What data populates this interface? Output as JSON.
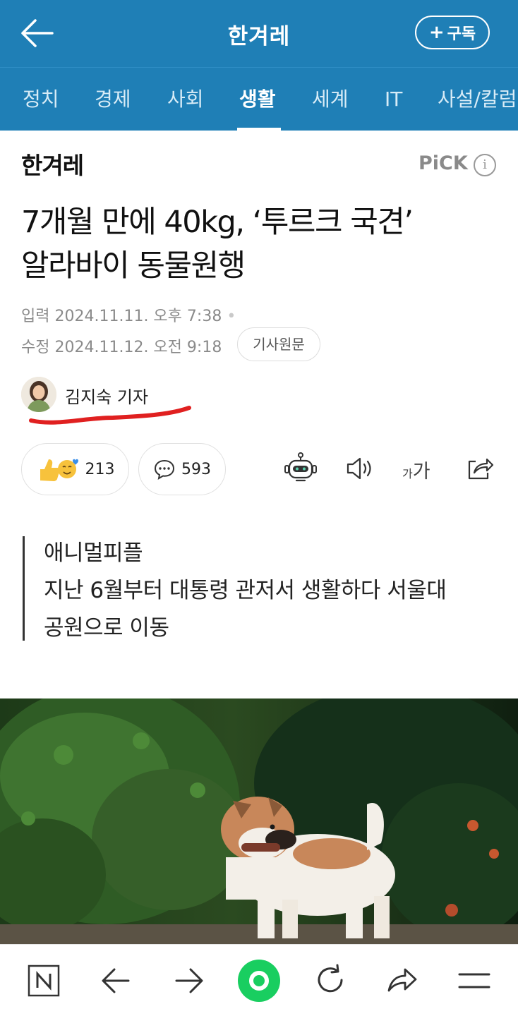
{
  "header": {
    "brand": "한겨레",
    "subscribe_label": "구독"
  },
  "tabs": [
    {
      "label": "정치"
    },
    {
      "label": "경제"
    },
    {
      "label": "사회"
    },
    {
      "label": "생활"
    },
    {
      "label": "세계"
    },
    {
      "label": "IT"
    },
    {
      "label": "사설/칼럼"
    }
  ],
  "active_tab": "생활",
  "publisher": {
    "logo_text": "한겨레",
    "pick_label": "PiCK",
    "info_symbol": "i"
  },
  "article": {
    "headline_line1": "7개월 만에 40kg, ‘투르크 국견’",
    "headline_line2": "알라바이 동물원행",
    "input_label": "입력",
    "input_date": "2024.11.11. 오후 7:38",
    "modified_label": "수정",
    "modified_date": "2024.11.12. 오전 9:18",
    "original_button": "기사원문",
    "reporter": "김지숙 기자",
    "reaction_count": "213",
    "comment_count": "593",
    "font_small": "가",
    "font_big": "가",
    "summary_line1": "애니멀피플",
    "summary_line2": "지난 6월부터 대통령 관저서 생활하다 서울대",
    "summary_line3": "공원으로 이동"
  },
  "colors": {
    "header_bg": "#1f7fb6",
    "highlight_red": "#e02020",
    "nav_green": "#19ce60"
  },
  "icons": {
    "back": "arrow-left-icon",
    "naver": "naver-n-icon",
    "forward": "arrow-right-icon",
    "home": "green-dot-icon",
    "refresh": "refresh-icon",
    "share": "share-icon",
    "menu": "menu-icon",
    "robot": "robot-icon",
    "speaker": "speaker-icon"
  }
}
